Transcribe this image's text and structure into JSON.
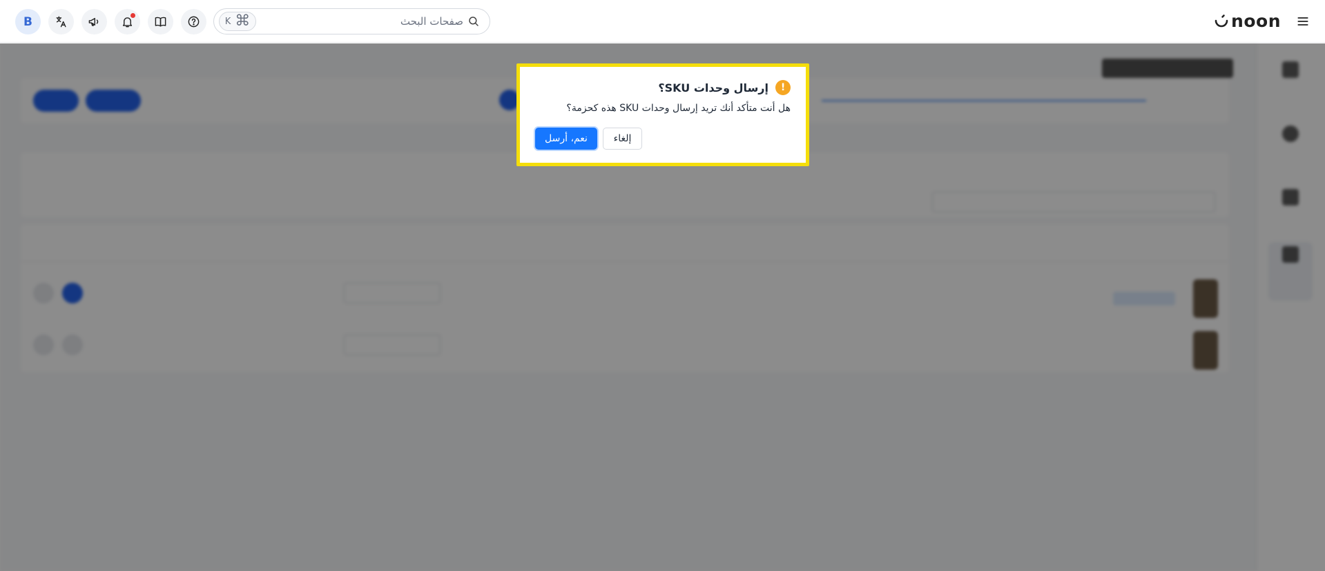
{
  "header": {
    "avatar_initial": "B",
    "search_placeholder": "صفحات البحث",
    "search_shortcut_key": "K",
    "search_shortcut_symbol": "⌘",
    "logo_text": "noon",
    "icons": [
      "translate-icon",
      "megaphone-icon",
      "bell-icon",
      "book-icon",
      "help-icon",
      "search-icon",
      "menu-icon"
    ],
    "notification_dot_color": "#e53935"
  },
  "modal": {
    "title": "إرسال وحدات SKU؟",
    "message": "هل أنت متأكد أنك تريد إرسال وحدات SKU هذه كحزمة؟",
    "confirm_label": "نعم، أرسل",
    "cancel_label": "إلغاء",
    "warning_symbol": "!",
    "warning_color": "#f5a623",
    "primary_color": "#1677ff",
    "highlight_color": "#f5de0b"
  }
}
